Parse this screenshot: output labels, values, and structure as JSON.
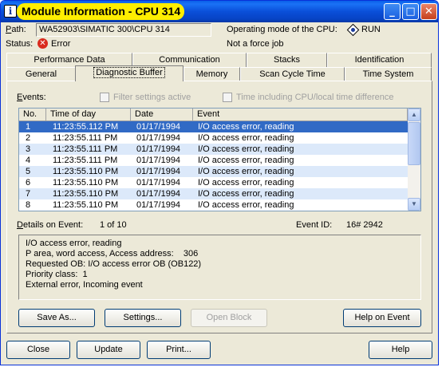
{
  "window": {
    "title": "Module Information - CPU 314",
    "icon_letter": "i"
  },
  "header": {
    "path_label": "Path:",
    "path_value": "WA52903\\SIMATIC 300\\CPU 314",
    "status_label": "Status:",
    "status_value": "Error",
    "mode_label": "Operating mode of the  CPU:",
    "mode_value": "RUN",
    "force_text": "Not a force job"
  },
  "tabs_top": [
    "Performance Data",
    "Communication",
    "Stacks",
    "Identification"
  ],
  "tabs_bottom": [
    "General",
    "Diagnostic Buffer",
    "Memory",
    "Scan Cycle Time",
    "Time System"
  ],
  "active_tab": "Diagnostic Buffer",
  "events": {
    "label": "Events:",
    "filter_label": "Filter settings active",
    "time_label": "Time including CPU/local time difference",
    "columns": [
      "No.",
      "Time of day",
      "Date",
      "Event"
    ],
    "rows": [
      {
        "no": "1",
        "time": "11:23:55.112 PM",
        "date": "01/17/1994",
        "event": "I/O access error, reading"
      },
      {
        "no": "2",
        "time": "11:23:55.111 PM",
        "date": "01/17/1994",
        "event": "I/O access error, reading"
      },
      {
        "no": "3",
        "time": "11:23:55.111 PM",
        "date": "01/17/1994",
        "event": "I/O access error, reading"
      },
      {
        "no": "4",
        "time": "11:23:55.111 PM",
        "date": "01/17/1994",
        "event": "I/O access error, reading"
      },
      {
        "no": "5",
        "time": "11:23:55.110 PM",
        "date": "01/17/1994",
        "event": "I/O access error, reading"
      },
      {
        "no": "6",
        "time": "11:23:55.110 PM",
        "date": "01/17/1994",
        "event": "I/O access error, reading"
      },
      {
        "no": "7",
        "time": "11:23:55.110 PM",
        "date": "01/17/1994",
        "event": "I/O access error, reading"
      },
      {
        "no": "8",
        "time": "11:23:55.110 PM",
        "date": "01/17/1994",
        "event": "I/O access error, reading"
      }
    ]
  },
  "details": {
    "label": "Details on Event:",
    "position": "1 of 10",
    "event_id_label": "Event ID:",
    "event_id": "16# 2942",
    "lines": [
      "I/O access error, reading",
      "P area, word access, Access address:    306",
      "Requested OB: I/O access error OB (OB122)",
      "Priority class:  1",
      "External error, Incoming event"
    ]
  },
  "buttons": {
    "save_as": "Save As...",
    "settings": "Settings...",
    "open_block": "Open Block",
    "help_on_event": "Help on Event",
    "close": "Close",
    "update": "Update",
    "print": "Print...",
    "help": "Help"
  }
}
